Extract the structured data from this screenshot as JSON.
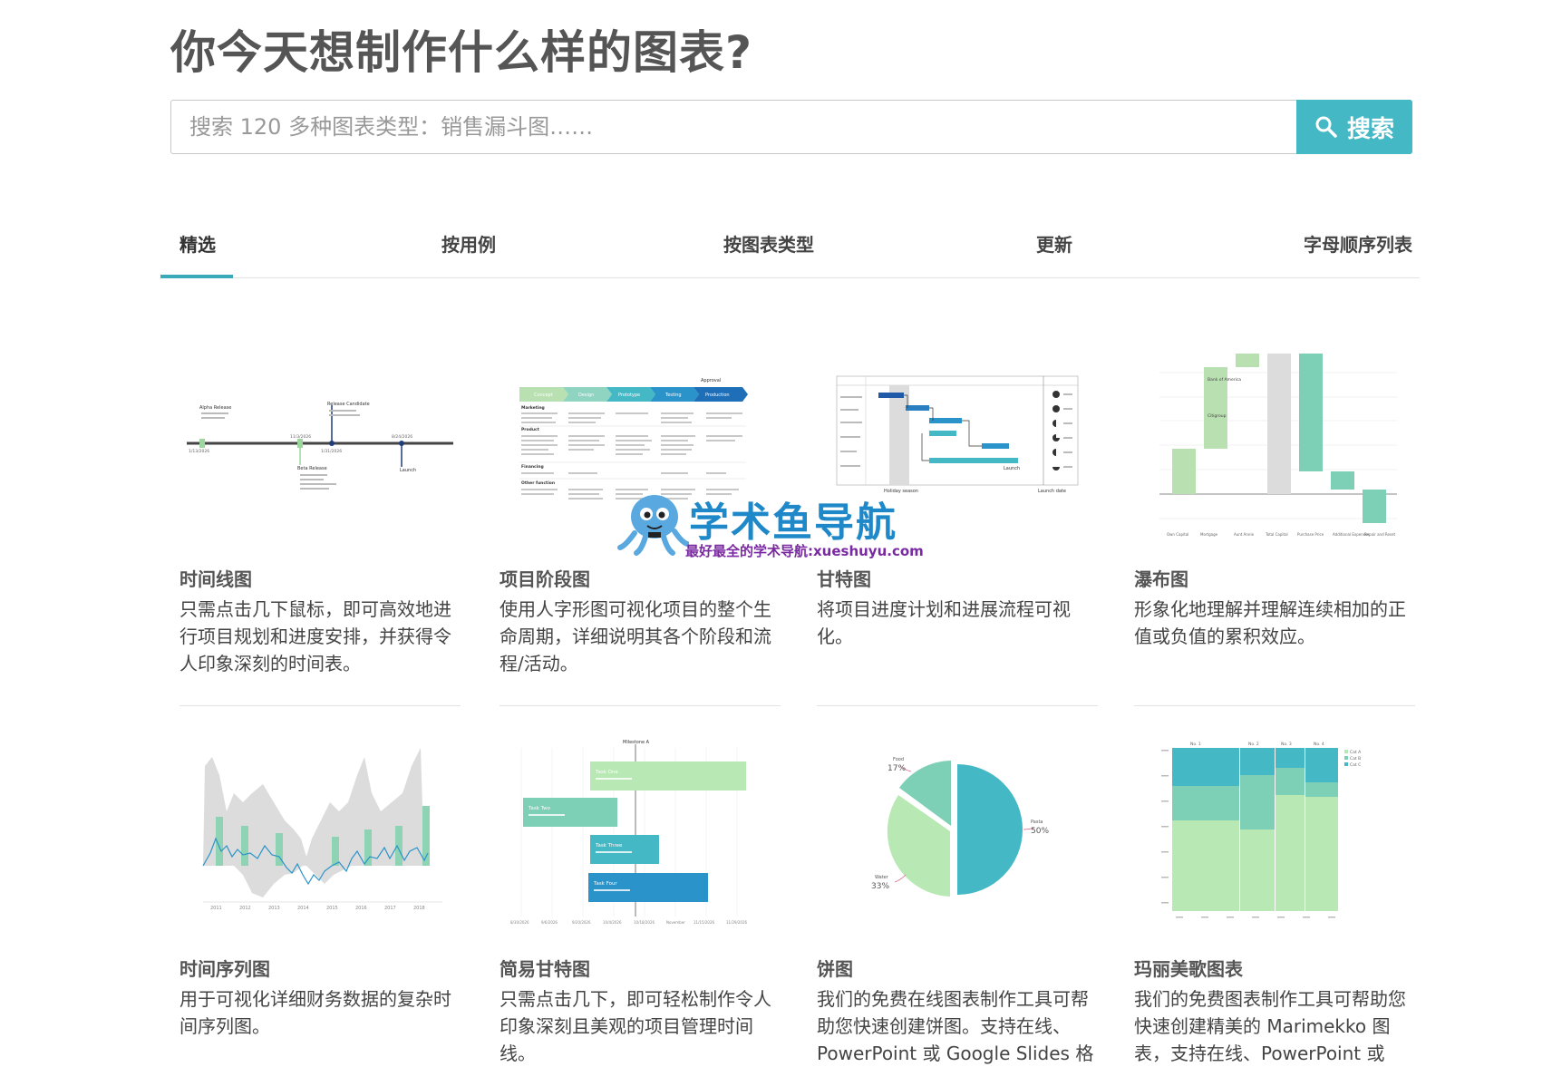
{
  "page_title": "你今天想制作什么样的图表?",
  "search": {
    "placeholder": "搜索 120 多种图表类型：销售漏斗图……",
    "button_label": "搜索"
  },
  "tabs": [
    {
      "label": "精选",
      "active": true
    },
    {
      "label": "按用例",
      "active": false
    },
    {
      "label": "按图表类型",
      "active": false
    },
    {
      "label": "更新",
      "active": false
    },
    {
      "label": "字母顺序列表",
      "active": false
    }
  ],
  "accent_color": "#45b8c5",
  "cards": [
    {
      "title": "时间线图",
      "description": "只需点击几下鼠标，即可高效地进行项目规划和进度安排，并获得令人印象深刻的时间表。",
      "thumbnail": "timeline-chart",
      "thumb_text": {
        "events": [
          "Alpha Release",
          "Release Candidate",
          "Beta Release",
          "Launch"
        ],
        "dates": [
          "1/13/2026",
          "11/3/2026",
          "1/31/2026",
          "8/24/2026"
        ]
      }
    },
    {
      "title": "项目阶段图",
      "description": "使用人字形图可视化项目的整个生命周期，详细说明其各个阶段和流程/活动。",
      "thumbnail": "project-phase-chart",
      "thumb_text": {
        "phases": [
          "Concept",
          "Design",
          "Prototype",
          "Testing",
          "Production"
        ],
        "approval": "Approval",
        "rows": [
          "Marketing",
          "Product",
          "Financing",
          "Other function"
        ]
      }
    },
    {
      "title": "甘特图",
      "description": "将项目进度计划和进展流程可视化。",
      "thumbnail": "gantt-chart",
      "thumb_text": {
        "markers": [
          "Holiday season",
          "Launch",
          "Launch date"
        ]
      }
    },
    {
      "title": "瀑布图",
      "description": "形象化地理解并理解连续相加的正值或负值的累积效应。",
      "thumbnail": "waterfall-chart",
      "thumb_text": {
        "labels": [
          "Bank of America",
          "Citigroup"
        ],
        "categories": [
          "Own Capital",
          "Mortgage",
          "Aunt Annie",
          "Total Capital",
          "Purchase Price",
          "Additional Expenses",
          "Repair and Reset"
        ]
      }
    },
    {
      "title": "时间序列图",
      "description": "用于可视化详细财务数据的复杂时间序列图。",
      "thumbnail": "time-series-chart",
      "thumb_text": {
        "years": [
          "2011",
          "2012",
          "2013",
          "2014",
          "2015",
          "2016",
          "2017",
          "2018"
        ]
      }
    },
    {
      "title": "简易甘特图",
      "description": "只需点击几下，即可轻松制作令人印象深刻且美观的项目管理时间线。",
      "thumbnail": "simple-gantt-chart",
      "thumb_text": {
        "milestone": "Milestone A",
        "tasks": [
          "Task One",
          "Task Two",
          "Task Three",
          "Task Four"
        ],
        "dates": [
          "8/30/2026",
          "9/6/2026",
          "9/20/2026",
          "10/4/2026",
          "10/18/2026",
          "November",
          "11/15/2026",
          "11/29/2026"
        ]
      }
    },
    {
      "title": "饼图",
      "description": "我们的免费在线图表制作工具可帮助您快速创建饼图。支持在线、PowerPoint 或 Google Slides 格",
      "thumbnail": "pie-chart",
      "thumb_text": {
        "slice_labels": [
          "Food",
          "Pasta",
          "Water"
        ],
        "slice_values": [
          "17%",
          "50%",
          "33%"
        ]
      }
    },
    {
      "title": "玛丽美歌图表",
      "description": "我们的免费图表制作工具可帮助您快速创建精美的 Marimekko 图表，支持在线、PowerPoint 或",
      "thumbnail": "marimekko-chart",
      "thumb_text": {
        "columns": [
          "No. 1",
          "No. 2",
          "No. 3",
          "No. 4"
        ],
        "legend": [
          "Cat A",
          "Cat B",
          "Cat C"
        ]
      }
    }
  ],
  "watermark": {
    "title": "学术鱼导航",
    "subtitle": "最好最全的学术导航:xueshuyu.com",
    "logo": "octopus-mascot-logo"
  }
}
